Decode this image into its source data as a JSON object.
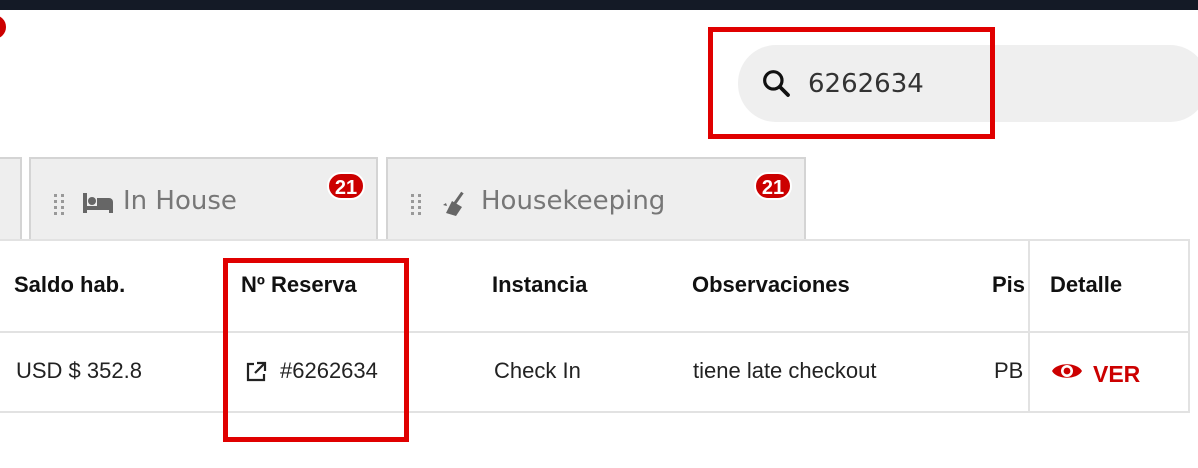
{
  "search": {
    "value": "6262634"
  },
  "tabs": [
    {
      "label": "In House",
      "count": "21",
      "icon": "bed-icon"
    },
    {
      "label": "Housekeeping",
      "count": "21",
      "icon": "broom-icon"
    }
  ],
  "table": {
    "headers": {
      "saldo": "Saldo hab.",
      "reserva": "Nº Reserva",
      "instancia": "Instancia",
      "observaciones": "Observaciones",
      "piso": "Pis",
      "detalle": "Detalle"
    },
    "row": {
      "saldo": "USD $ 352.8",
      "reserva": "#6262634",
      "instancia": "Check In",
      "observaciones": "tiene late checkout",
      "piso": "PB",
      "detalle_label": "VER"
    }
  },
  "colors": {
    "accent": "#cc0000",
    "highlight": "#e00000",
    "topbar": "#141a26"
  }
}
